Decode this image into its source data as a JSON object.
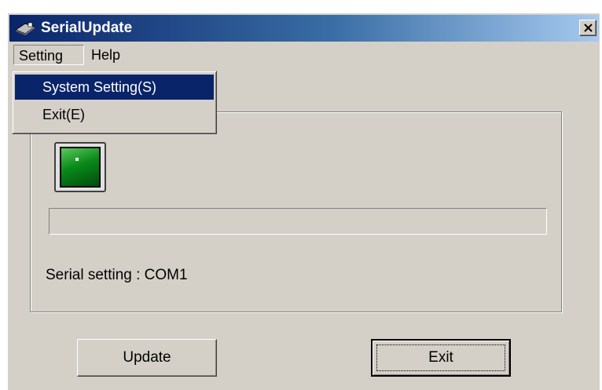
{
  "window": {
    "title": "SerialUpdate",
    "app_icon": "chip-app-icon",
    "close_icon": "close-icon"
  },
  "menubar": {
    "items": [
      {
        "label": "Setting",
        "open": true
      },
      {
        "label": "Help",
        "open": false
      }
    ]
  },
  "setting_menu": {
    "items": [
      {
        "label": "System Setting(S)",
        "selected": true
      },
      {
        "label": "Exit(E)",
        "selected": false
      }
    ]
  },
  "main": {
    "device_icon": "green-chip-icon",
    "progress": 0,
    "serial_setting_text": "Serial setting : COM1"
  },
  "buttons": {
    "update_label": "Update",
    "exit_label": "Exit"
  },
  "colors": {
    "title_gradient_start": "#0a246a",
    "title_gradient_end": "#a6caf0",
    "menu_highlight": "#0a246a",
    "face": "#d4d0c8"
  }
}
